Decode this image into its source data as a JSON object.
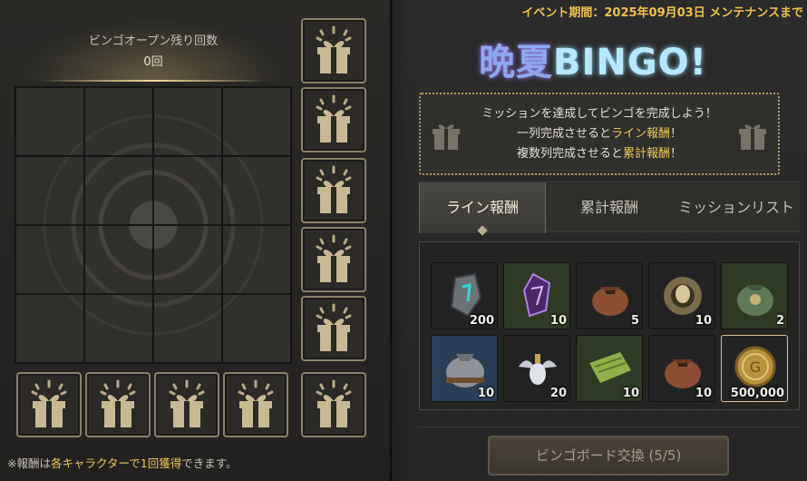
{
  "left_panel": {
    "open_count_label": "ビンゴオープン残り回数",
    "open_count_value": "0回",
    "note": {
      "prefix": "※報酬は",
      "highlight": "各キャラクターで1回獲得",
      "suffix": "できます。"
    }
  },
  "right_panel": {
    "event_period": "イベント期間：2025年09月03日 メンテナンスまで",
    "title_main": "晩夏",
    "title_accent": "BINGO!",
    "mission_box": {
      "line1": "ミッションを達成してビンゴを完成しよう！",
      "line2_prefix": "一列完成させると",
      "line2_highlight": "ライン報酬",
      "line2_suffix": "！",
      "line3_prefix": "複数列完成させると",
      "line3_highlight": "累計報酬",
      "line3_suffix": "！"
    },
    "tabs": [
      {
        "label": "ライン報酬",
        "active": true
      },
      {
        "label": "累計報酬",
        "active": false
      },
      {
        "label": "ミッションリスト",
        "active": false
      }
    ],
    "rewards": [
      {
        "icon": "gray-crystal-stone-icon",
        "qty": "200"
      },
      {
        "icon": "purple-crystal-icon",
        "qty": "10"
      },
      {
        "icon": "brown-pouch-icon",
        "qty": "5"
      },
      {
        "icon": "golden-nest-icon",
        "qty": "10"
      },
      {
        "icon": "green-pouch-icon",
        "qty": "2"
      },
      {
        "icon": "silver-pouch-icon",
        "qty": "10"
      },
      {
        "icon": "winged-potion-icon",
        "qty": "20"
      },
      {
        "icon": "green-scroll-icon",
        "qty": "10"
      },
      {
        "icon": "brown-pouch-icon",
        "qty": "10"
      },
      {
        "icon": "gold-coin-icon",
        "qty": "500,000"
      }
    ],
    "exchange_button": "ビンゴボード交換 (5/5)"
  },
  "colors": {
    "highlight": "#efc65a",
    "event_text": "#f1c24b",
    "title_main": "#8ea8f0",
    "title_accent": "#b7e8ff"
  }
}
